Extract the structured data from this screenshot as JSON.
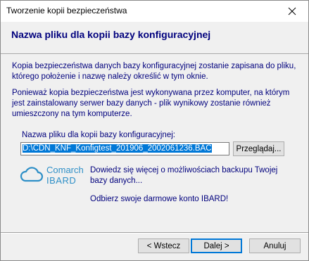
{
  "window": {
    "title": "Tworzenie kopii bezpieczeństwa"
  },
  "header": {
    "title": "Nazwa pliku dla kopii bazy konfiguracyjnej"
  },
  "body": {
    "paragraph1": "Kopia bezpieczeństwa danych bazy konfiguracyjnej zostanie zapisana do pliku, którego położenie i nazwę należy określić w tym oknie.",
    "paragraph2": "Ponieważ kopia bezpieczeństwa jest wykonywana przez komputer, na którym jest zainstalowany serwer bazy danych - plik wynikowy zostanie również umieszczony na tym komputerze.",
    "field_label": "Nazwa pliku dla kopii bazy konfiguracyjnej:",
    "field_value": "D:\\CDN_KNF_Konfigtest_201906_2002061236.BAC",
    "browse_label": "Przeglądaj..."
  },
  "promo": {
    "logo_line1": "Comarch",
    "logo_line2": "IBARD",
    "link_more": "Dowiedz się więcej o możliwościach backupu Twojej bazy danych...",
    "link_account": "Odbierz swoje darmowe konto IBARD!"
  },
  "footer": {
    "back_label": "< Wstecz",
    "next_label": "Dalej >",
    "cancel_label": "Anuluj"
  },
  "colors": {
    "accent_text": "#00007d",
    "selection": "#0078d7",
    "logo": "#2e8fc7"
  }
}
